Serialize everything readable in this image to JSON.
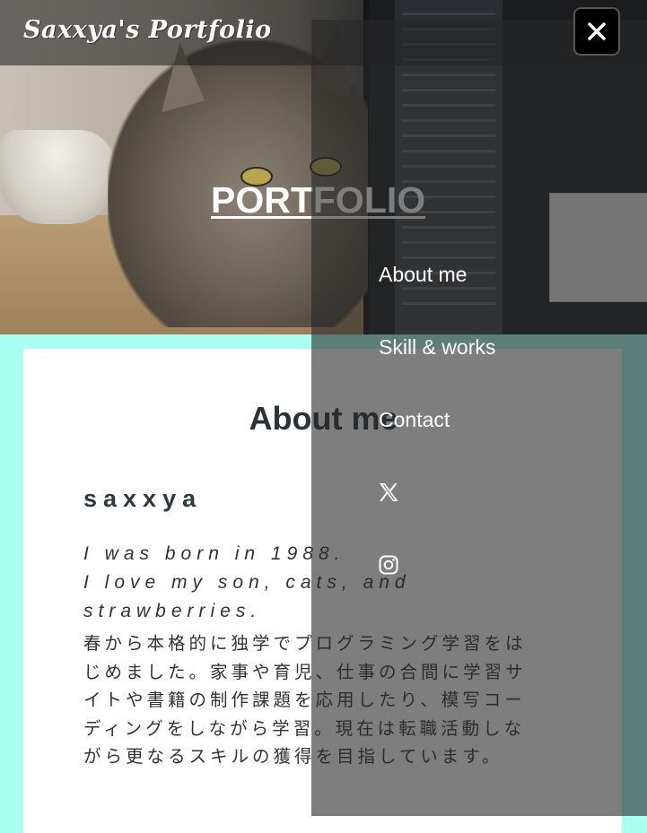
{
  "header": {
    "site_title": "Saxxya's Portfolio"
  },
  "hero": {
    "heading": "PORTFOLIO"
  },
  "nav": {
    "items": [
      {
        "label": "About me"
      },
      {
        "label": "Skill & works"
      },
      {
        "label": "Contact"
      }
    ],
    "social": [
      "x-icon",
      "instagram-icon"
    ],
    "close_icon": "close-icon"
  },
  "about": {
    "title": "About me",
    "name": "saxxya",
    "intro_line1": "I was born in 1988.",
    "intro_line2": "I love my son, cats, and strawberries.",
    "bio": "春から本格的に独学でプログラミング学習をはじめました。家事や育児、仕事の合間に学習サイトや書籍の制作課題を応用したり、模写コーディングをしながら学習。現在は転職活動しながら更なるスキルの獲得を目指しています。"
  },
  "colors": {
    "accent": "#a9fff2",
    "overlay": "#3c3c3c",
    "text": "#2b3338"
  }
}
